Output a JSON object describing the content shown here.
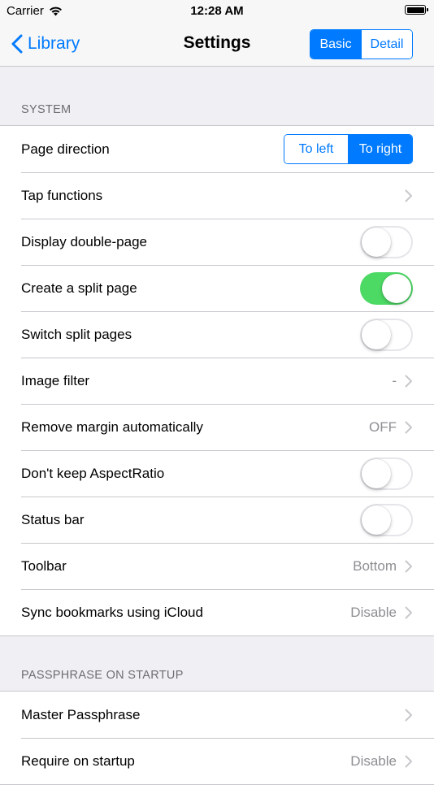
{
  "status_bar": {
    "carrier": "Carrier",
    "time": "12:28 AM",
    "wifi_icon": "wifi-icon",
    "battery_icon": "battery-icon"
  },
  "nav": {
    "back_label": "Library",
    "title": "Settings",
    "mode_segments": [
      {
        "label": "Basic",
        "selected": true
      },
      {
        "label": "Detail",
        "selected": false
      }
    ]
  },
  "system": {
    "header": "SYSTEM",
    "page_direction": {
      "label": "Page direction",
      "options": [
        "To left",
        "To right"
      ],
      "selected": "To right"
    },
    "tap_functions": {
      "label": "Tap functions"
    },
    "display_double_page": {
      "label": "Display double-page",
      "on": false
    },
    "create_split_page": {
      "label": "Create a split page",
      "on": true
    },
    "switch_split_pages": {
      "label": "Switch split pages",
      "on": false
    },
    "image_filter": {
      "label": "Image filter",
      "value": "-"
    },
    "remove_margin": {
      "label": "Remove margin automatically",
      "value": "OFF"
    },
    "keep_aspect": {
      "label": "Don't keep AspectRatio",
      "on": false
    },
    "status_bar_toggle": {
      "label": "Status bar",
      "on": false
    },
    "toolbar": {
      "label": "Toolbar",
      "value": "Bottom"
    },
    "sync_bookmarks": {
      "label": "Sync bookmarks using iCloud",
      "value": "Disable"
    }
  },
  "passphrase": {
    "header": "PASSPHRASE ON STARTUP",
    "master": {
      "label": "Master Passphrase"
    },
    "require": {
      "label": "Require on startup",
      "value": "Disable"
    }
  },
  "colors": {
    "accent": "#007aff",
    "toggle_on": "#4cd964",
    "background": "#efeff4",
    "secondary_text": "#8e8e93"
  }
}
